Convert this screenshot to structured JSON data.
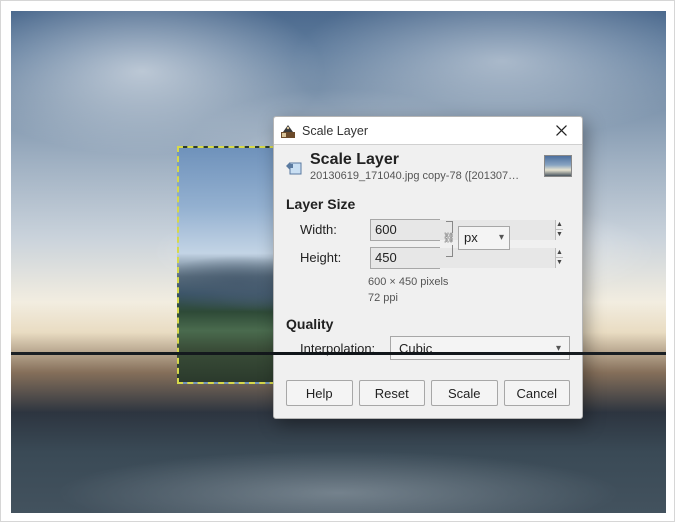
{
  "window": {
    "title": "Scale Layer"
  },
  "header": {
    "title": "Scale Layer",
    "subtitle": "20130619_171040.jpg copy-78 ([20130701_…"
  },
  "layer_size": {
    "section_title": "Layer Size",
    "width_label": "Width:",
    "height_label": "Height:",
    "width_value": "600",
    "height_value": "450",
    "unit": "px",
    "pixel_summary": "600 × 450 pixels",
    "ppi_summary": "72 ppi"
  },
  "quality": {
    "section_title": "Quality",
    "interpolation_label": "Interpolation:",
    "interpolation_value": "Cubic"
  },
  "buttons": {
    "help": "Help",
    "reset": "Reset",
    "scale": "Scale",
    "cancel": "Cancel"
  }
}
